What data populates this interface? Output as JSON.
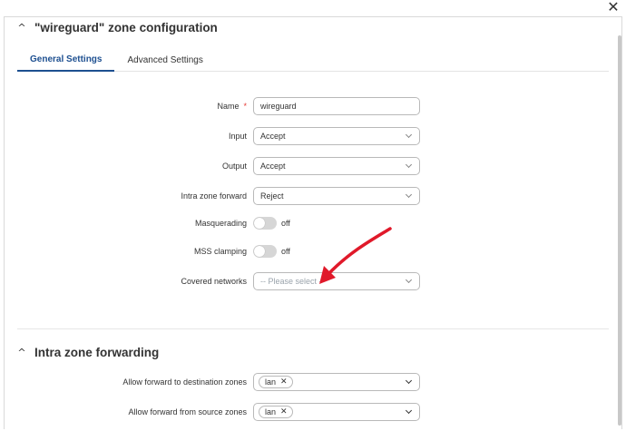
{
  "window": {
    "close_glyph": "✕",
    "close_icon": "close-icon"
  },
  "zone_section": {
    "chevron": "^",
    "title": "\"wireguard\" zone configuration",
    "tabs": [
      {
        "label": "General Settings",
        "active": true
      },
      {
        "label": "Advanced Settings",
        "active": false
      }
    ],
    "fields": {
      "name": {
        "label": "Name",
        "required_mark": "*",
        "value": "wireguard"
      },
      "input": {
        "label": "Input",
        "value": "Accept"
      },
      "output": {
        "label": "Output",
        "value": "Accept"
      },
      "intra_zone_forward": {
        "label": "Intra zone forward",
        "value": "Reject"
      },
      "masquerading": {
        "label": "Masquerading",
        "state": "off"
      },
      "mss_clamping": {
        "label": "MSS clamping",
        "state": "off"
      },
      "covered_networks": {
        "label": "Covered networks",
        "placeholder": "-- Please select --"
      }
    }
  },
  "forwarding_section": {
    "chevron": "^",
    "title": "Intra zone forwarding",
    "fields": {
      "dest_zones": {
        "label": "Allow forward to destination zones",
        "chips": [
          "lan"
        ]
      },
      "source_zones": {
        "label": "Allow forward from source zones",
        "chips": [
          "lan"
        ]
      }
    }
  },
  "chip_remove_glyph": "✕",
  "colors": {
    "accent": "#1d4f90",
    "annotation_arrow": "#e0192a",
    "required": "#e53935"
  }
}
